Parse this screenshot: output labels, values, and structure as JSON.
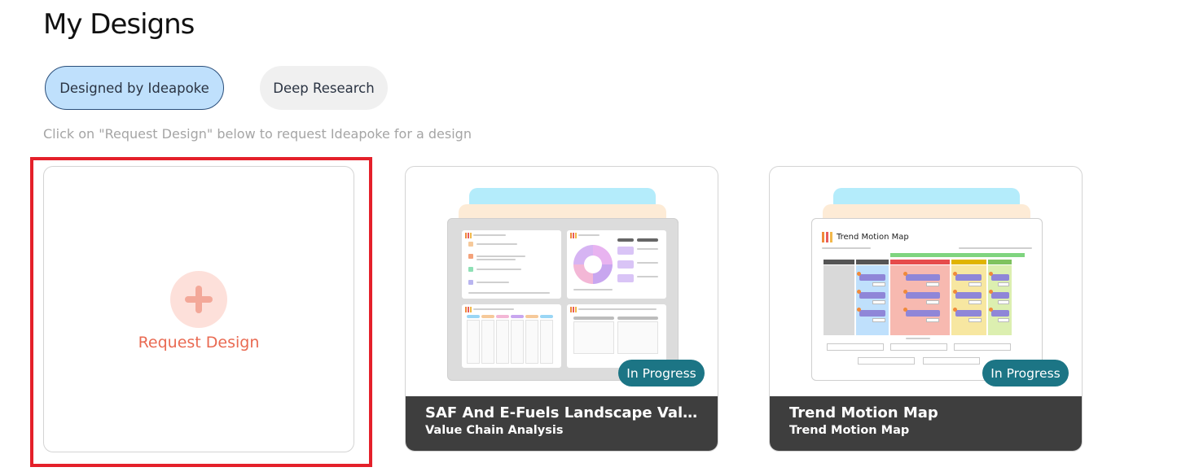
{
  "page": {
    "title": "My Designs",
    "hint": "Click on \"Request Design\" below to request Ideapoke for a design"
  },
  "tabs": [
    {
      "label": "Designed by Ideapoke",
      "active": true
    },
    {
      "label": "Deep Research",
      "active": false
    }
  ],
  "request_card": {
    "label": "Request Design",
    "icon": "plus-icon"
  },
  "designs": [
    {
      "title": "SAF And E-Fuels Landscape Valu...",
      "subtitle": "Value Chain Analysis",
      "status": "In Progress",
      "thumbnail": "value-chain-analysis-preview"
    },
    {
      "title": "Trend Motion Map",
      "subtitle": "Trend Motion Map",
      "status": "In Progress",
      "thumbnail": "trend-motion-map-preview",
      "thumbnail_title": "Trend Motion Map"
    }
  ],
  "colors": {
    "active_tab_bg": "#bfe0fc",
    "inactive_tab_bg": "#f0f0f0",
    "status_badge": "#1c7585",
    "card_footer": "#3e3e3e",
    "request_accent": "#e96a52",
    "highlight_border": "#e4202a"
  }
}
